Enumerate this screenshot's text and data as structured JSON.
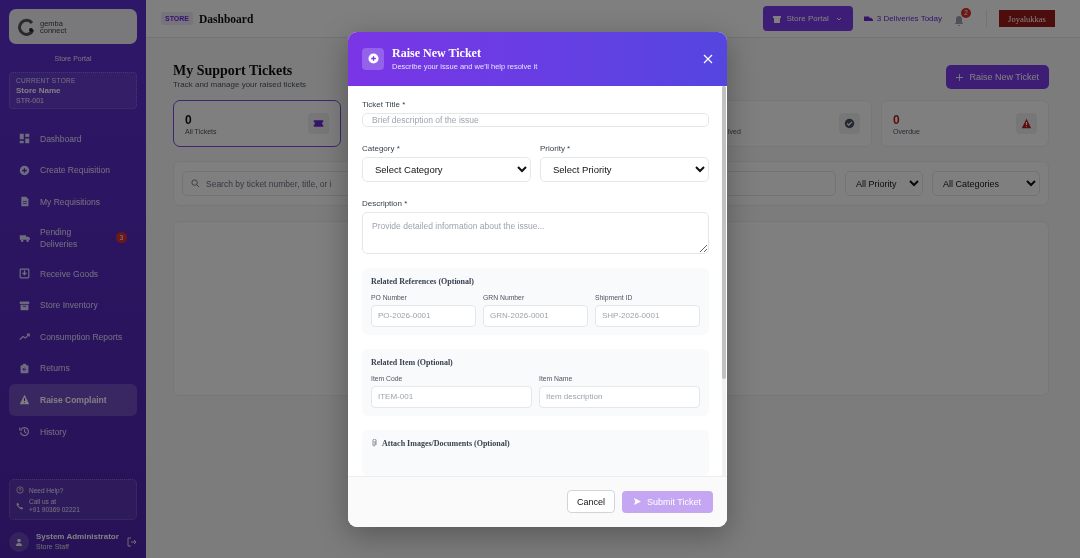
{
  "sidebar": {
    "logo": {
      "line_1": "gemba",
      "line_2": "connect"
    },
    "portal": "Store Portal",
    "current_store": {
      "label": "CURRENT STORE",
      "name": "Store Name",
      "code": "STR-001"
    },
    "items": [
      {
        "label": "Dashboard",
        "selected": false
      },
      {
        "label": "Create Requisition",
        "selected": false
      },
      {
        "label": "My Requisitions",
        "selected": false
      },
      {
        "label": "Pending Deliveries",
        "badge": "3",
        "selected": false
      },
      {
        "label": "Receive Goods",
        "selected": false
      },
      {
        "label": "Store Inventory",
        "selected": false
      },
      {
        "label": "Consumption Reports",
        "selected": false
      },
      {
        "label": "Returns",
        "selected": false
      },
      {
        "label": "Raise Complaint",
        "selected": true
      },
      {
        "label": "History",
        "selected": false
      }
    ],
    "help": {
      "title": "Need Help?",
      "line_1": "Call us at",
      "phone": "+91 90369 02221"
    },
    "user": {
      "name": "System Administrator",
      "role": "Store Staff"
    }
  },
  "header": {
    "badge": "STORE",
    "title": "Dashboard",
    "portal_button": "Store Portal",
    "deliveries": "3 Deliveries Today",
    "notifications": "2",
    "brand": "Joyalukkas"
  },
  "page": {
    "title": "My Support Tickets",
    "subtitle": "Track and manage your raised tickets",
    "raise_button": "Raise New Ticket",
    "stat_cards": [
      {
        "value": "0",
        "label": "All Tickets",
        "selected": true
      },
      {
        "label": "lved",
        "selected": false
      },
      {
        "value": "0",
        "label": "Overdue",
        "selected": false
      }
    ],
    "search": {
      "placeholder": "Search by ticket number, title, or i"
    },
    "filters": [
      "All Priority",
      "All Categories"
    ]
  },
  "modal": {
    "title": "Raise New Ticket",
    "subtitle": "Describe your issue and we'll help resolve it",
    "ticket_title": {
      "label": "Ticket Title *",
      "placeholder": "Brief description of the issue"
    },
    "category": {
      "label": "Category *",
      "value": "Select Category"
    },
    "priority": {
      "label": "Priority *",
      "value": "Select Priority"
    },
    "description": {
      "label": "Description *",
      "placeholder": "Provide detailed information about the issue..."
    },
    "references": {
      "title": "Related References (Optional)",
      "fields": [
        {
          "label": "PO Number",
          "placeholder": "PO-2026-0001"
        },
        {
          "label": "GRN Number",
          "placeholder": "GRN-2026-0001"
        },
        {
          "label": "Shipment ID",
          "placeholder": "SHP-2026-0001"
        }
      ]
    },
    "item": {
      "title": "Related Item (Optional)",
      "fields": [
        {
          "label": "Item Code",
          "placeholder": "ITEM-001"
        },
        {
          "label": "Item Name",
          "placeholder": "Item description"
        }
      ]
    },
    "attachments": {
      "title": "Attach Images/Documents (Optional)"
    },
    "cancel": "Cancel",
    "submit": {
      "label": "Submit Ticket",
      "disabled": true
    }
  }
}
